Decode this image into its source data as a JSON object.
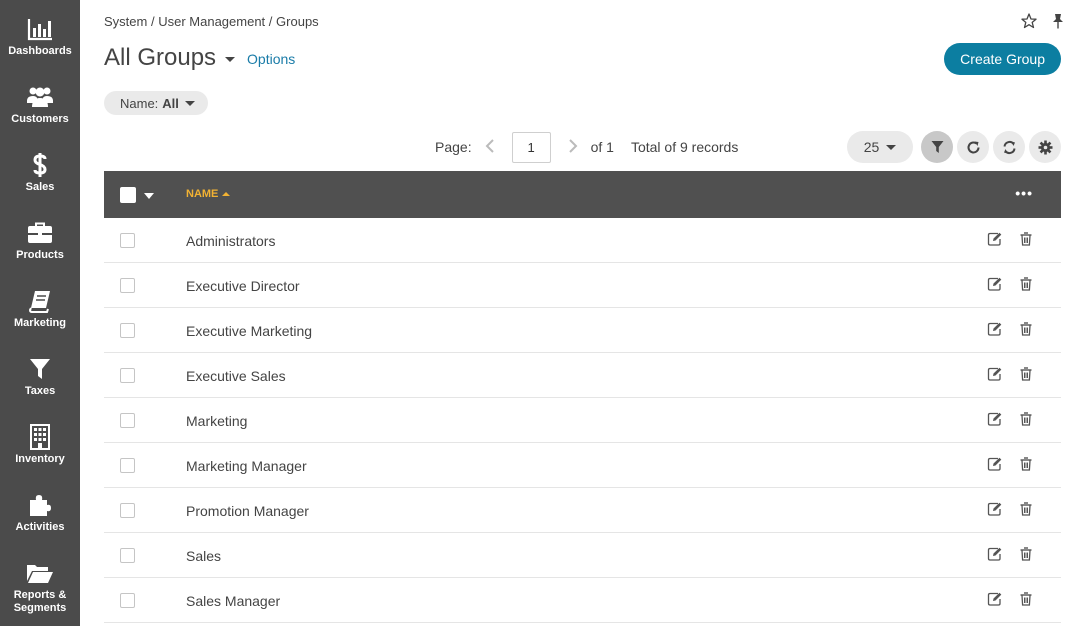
{
  "sidebar": {
    "items": [
      {
        "label": "Dashboards",
        "icon": "bar-chart-icon"
      },
      {
        "label": "Customers",
        "icon": "users-icon"
      },
      {
        "label": "Sales",
        "icon": "dollar-icon"
      },
      {
        "label": "Products",
        "icon": "briefcase-icon"
      },
      {
        "label": "Marketing",
        "icon": "book-icon"
      },
      {
        "label": "Taxes",
        "icon": "filter-icon"
      },
      {
        "label": "Inventory",
        "icon": "building-icon"
      },
      {
        "label": "Activities",
        "icon": "puzzle-icon"
      },
      {
        "label": "Reports &\nSegments",
        "icon": "folder-open-icon"
      }
    ]
  },
  "breadcrumb": {
    "items": [
      "System",
      "User Management",
      "Groups"
    ],
    "separator": "/"
  },
  "header": {
    "title": "All Groups",
    "options_label": "Options",
    "create_label": "Create Group"
  },
  "filter": {
    "label": "Name:",
    "value": "All"
  },
  "pager": {
    "page_label": "Page:",
    "current_page": "1",
    "of_label": "of 1",
    "total_label": "Total of 9 records",
    "page_size": "25"
  },
  "grid": {
    "column_name": "NAME",
    "more_label": "•••",
    "rows": [
      "Administrators",
      "Executive Director",
      "Executive Marketing",
      "Executive Sales",
      "Marketing",
      "Marketing Manager",
      "Promotion Manager",
      "Sales",
      "Sales Manager"
    ]
  },
  "colors": {
    "sidebar_bg": "#4b4b4b",
    "accent": "#0c7ea1",
    "link": "#1a7ca8",
    "grid_header_bg": "#505050",
    "sort_active": "#f2b233"
  }
}
